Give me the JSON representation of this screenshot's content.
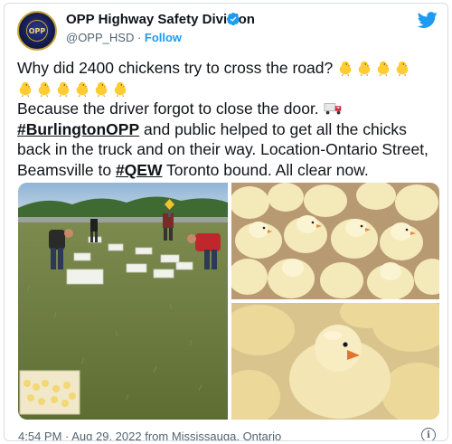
{
  "account": {
    "display_name": "OPP Highway Safety Division",
    "handle": "@OPP_HSD",
    "separator": " · ",
    "follow_label": "Follow",
    "avatar_text": "OPP"
  },
  "tweet": {
    "line1": "Why did 2400 chickens try to cross the road?",
    "line2_a": "Because the driver forgot to close the door.",
    "hashtag_burlington": "#BurlingtonOPP",
    "line2_b": " and public helped to get all the chicks back in the truck and on their way. Location-Ontario Street, Beamsville to ",
    "hashtag_qew": "#QEW",
    "line2_c": " Toronto bound. All clear now.",
    "emoji_chick": "baby-chick-icon",
    "emoji_truck": "delivery-truck-icon"
  },
  "meta": {
    "timestamp": "4:54 PM · Aug 29, 2022 from Mississauga, Ontario",
    "info_glyph": "i"
  },
  "colors": {
    "link": "#1d9bf0",
    "text": "#0f1419",
    "secondary": "#536471",
    "verified": "#1d9bf0"
  }
}
